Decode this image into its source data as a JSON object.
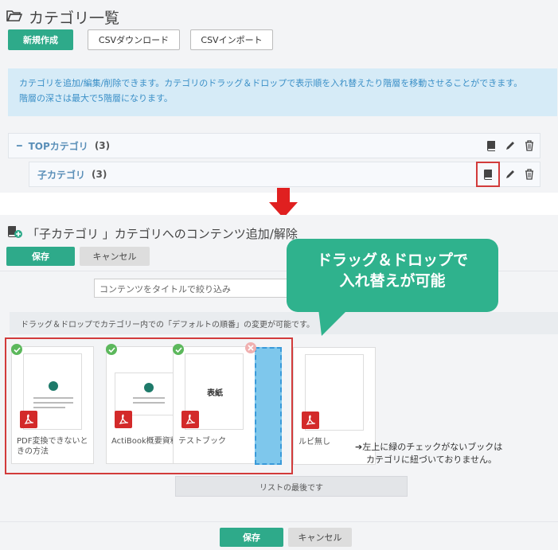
{
  "category_list": {
    "title": "カテゴリ一覧",
    "buttons": {
      "new": "新規作成",
      "csv_download": "CSVダウンロード",
      "csv_import": "CSVインポート"
    },
    "info_line1": "カテゴリを追加/編集/削除できます。カテゴリのドラッグ＆ドロップで表示順を入れ替えたり階層を移動させることができます。",
    "info_line2": "階層の深さは最大で5階層になります。",
    "rows": [
      {
        "toggle": "━",
        "label": "TOPカテゴリ",
        "count": "(3)"
      },
      {
        "label": "子カテゴリ",
        "count": "(3)"
      }
    ]
  },
  "content_editor": {
    "title": "「子カテゴリ 」カテゴリへのコンテンツ追加/解除",
    "save": "保存",
    "cancel": "キャンセル",
    "filter_placeholder": "コンテンツをタイトルで絞り込み",
    "dnd_hint": "ドラッグ＆ドロップでカテゴリー内での「デフォルトの順番」の変更が可能です。",
    "callout_line1": "ドラッグ＆ドロップで",
    "callout_line2": "入れ替えが可能",
    "cards": [
      {
        "caption": "PDF変換できないときの方法",
        "checked": true
      },
      {
        "caption": "ActiBook概要資料",
        "checked": true
      },
      {
        "caption": "テストブック",
        "thumb_text": "表紙",
        "checked": true
      },
      {
        "caption": "ルビ無し",
        "checked": false
      }
    ],
    "note_line1": "➔左上に緑のチェックがないブックは",
    "note_line2": "カテゴリに紐づいておりません。",
    "list_end": "リストの最後です",
    "footer_save": "保存",
    "footer_cancel": "キャンセル"
  },
  "colors": {
    "accent": "#2eaa8a",
    "highlight": "#d23b3b",
    "info_bg": "#d6ebf7",
    "link": "#5a8fb8"
  }
}
